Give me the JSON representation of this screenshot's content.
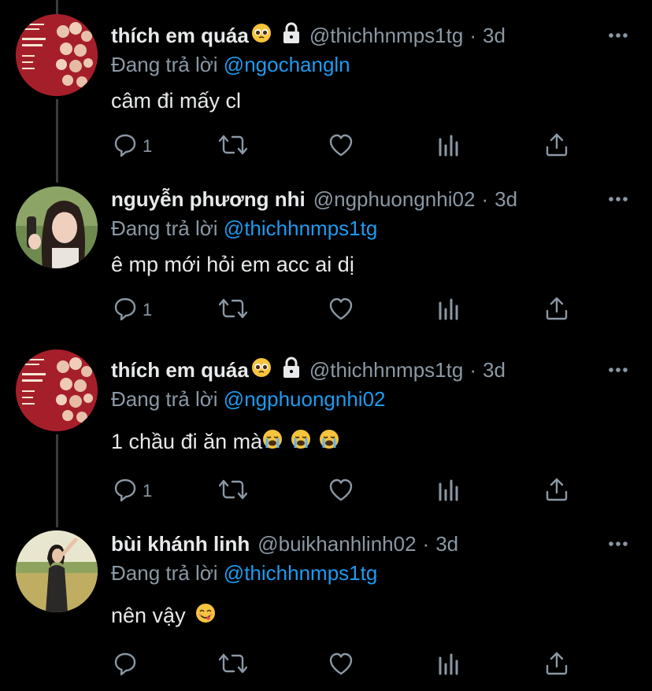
{
  "colors": {
    "background": "#000000",
    "text": "#e7e9ea",
    "muted": "#8b98a5",
    "link": "#1d9bf0"
  },
  "reply_prefix": "Đang trả lời",
  "tweets": [
    {
      "name": "thích em quáa",
      "name_emoji": "pleading-face-emoji",
      "locked": true,
      "handle": "@thichhnmps1tg",
      "separator": "·",
      "time": "3d",
      "reply_to": "@ngochangln",
      "text": "câm đi mấy cl",
      "emojis": [],
      "reply_count": "1",
      "avatar": "red-poster-avatar"
    },
    {
      "name": "nguyễn phương nhi",
      "name_emoji": "",
      "locked": false,
      "handle": "@ngphuongnhi02",
      "separator": "·",
      "time": "3d",
      "reply_to": "@thichhnmps1tg",
      "text": "ê mp mới hỏi em acc ai dị",
      "emojis": [],
      "reply_count": "1",
      "avatar": "girl-portrait-avatar"
    },
    {
      "name": "thích em quáa",
      "name_emoji": "pleading-face-emoji",
      "locked": true,
      "handle": "@thichhnmps1tg",
      "separator": "·",
      "time": "3d",
      "reply_to": "@ngphuongnhi02",
      "text": "1 chầu đi ăn mà",
      "emojis": [
        "loudly-crying-face-emoji",
        "loudly-crying-face-emoji",
        "loudly-crying-face-emoji"
      ],
      "reply_count": "1",
      "avatar": "red-poster-avatar"
    },
    {
      "name": "bùi khánh linh",
      "name_emoji": "",
      "locked": false,
      "handle": "@buikhanhlinh02",
      "separator": "·",
      "time": "3d",
      "reply_to": "@thichhnmps1tg",
      "text": "nên vậy",
      "emojis": [
        "face-savoring-food-emoji"
      ],
      "reply_count": "",
      "avatar": "field-photo-avatar"
    }
  ]
}
